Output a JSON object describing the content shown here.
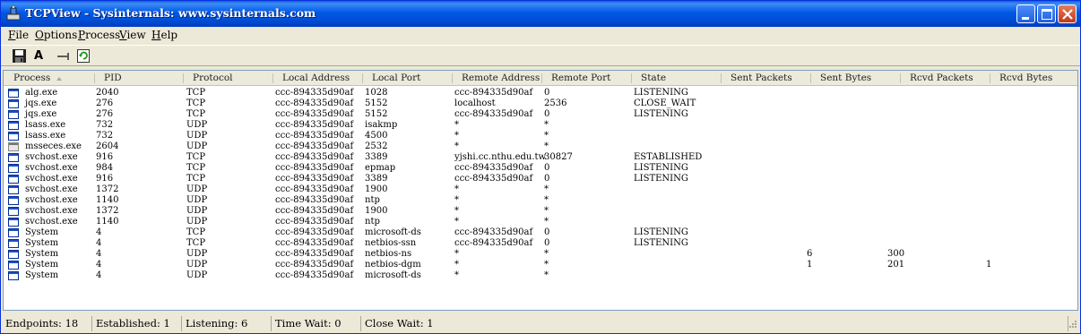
{
  "window": {
    "title": "TCPView - Sysinternals: www.sysinternals.com",
    "colors": {
      "titlebar": "#0058e6",
      "close_button": "#c4381c",
      "listening": "#000000"
    }
  },
  "menu": {
    "file": {
      "mnemonic": "F",
      "rest": "ile"
    },
    "options": {
      "mnemonic": "O",
      "rest": "ptions"
    },
    "process": {
      "mnemonic": "P",
      "rest": "rocess"
    },
    "view": {
      "mnemonic": "V",
      "rest": "iew"
    },
    "help": {
      "mnemonic": "H",
      "rest": "elp"
    }
  },
  "toolbar": {
    "save_icon": "floppy-disk-icon",
    "font_label": "A",
    "resolve_icon": "arrow-right-icon",
    "refresh_icon": "refresh-icon"
  },
  "columns": [
    "Process",
    "PID",
    "Protocol",
    "Local Address",
    "Local Port",
    "Remote Address",
    "Remote Port",
    "State",
    "Sent Packets",
    "Sent Bytes",
    "Rcvd Packets",
    "Rcvd Bytes"
  ],
  "rows": [
    {
      "icon": "app",
      "process": "alg.exe",
      "pid": "2040",
      "protocol": "TCP",
      "local_address": "ccc-894335d90af",
      "local_port": "1028",
      "remote_address": "ccc-894335d90af",
      "remote_port": "0",
      "state": "LISTENING",
      "sent_packets": "",
      "sent_bytes": "",
      "rcvd_packets": "",
      "rcvd_bytes": ""
    },
    {
      "icon": "app",
      "process": "jqs.exe",
      "pid": "276",
      "protocol": "TCP",
      "local_address": "ccc-894335d90af",
      "local_port": "5152",
      "remote_address": "localhost",
      "remote_port": "2536",
      "state": "CLOSE_WAIT",
      "sent_packets": "",
      "sent_bytes": "",
      "rcvd_packets": "",
      "rcvd_bytes": ""
    },
    {
      "icon": "app",
      "process": "jqs.exe",
      "pid": "276",
      "protocol": "TCP",
      "local_address": "ccc-894335d90af",
      "local_port": "5152",
      "remote_address": "ccc-894335d90af",
      "remote_port": "0",
      "state": "LISTENING",
      "sent_packets": "",
      "sent_bytes": "",
      "rcvd_packets": "",
      "rcvd_bytes": ""
    },
    {
      "icon": "app",
      "process": "lsass.exe",
      "pid": "732",
      "protocol": "UDP",
      "local_address": "ccc-894335d90af",
      "local_port": "isakmp",
      "remote_address": "*",
      "remote_port": "*",
      "state": "",
      "sent_packets": "",
      "sent_bytes": "",
      "rcvd_packets": "",
      "rcvd_bytes": ""
    },
    {
      "icon": "app",
      "process": "lsass.exe",
      "pid": "732",
      "protocol": "UDP",
      "local_address": "ccc-894335d90af",
      "local_port": "4500",
      "remote_address": "*",
      "remote_port": "*",
      "state": "",
      "sent_packets": "",
      "sent_bytes": "",
      "rcvd_packets": "",
      "rcvd_bytes": ""
    },
    {
      "icon": "ms",
      "process": "msseces.exe",
      "pid": "2604",
      "protocol": "UDP",
      "local_address": "ccc-894335d90af",
      "local_port": "2532",
      "remote_address": "*",
      "remote_port": "*",
      "state": "",
      "sent_packets": "",
      "sent_bytes": "",
      "rcvd_packets": "",
      "rcvd_bytes": ""
    },
    {
      "icon": "app",
      "process": "svchost.exe",
      "pid": "916",
      "protocol": "TCP",
      "local_address": "ccc-894335d90af",
      "local_port": "3389",
      "remote_address": "yjshi.cc.nthu.edu.tw",
      "remote_port": "30827",
      "state": "ESTABLISHED",
      "sent_packets": "",
      "sent_bytes": "",
      "rcvd_packets": "",
      "rcvd_bytes": ""
    },
    {
      "icon": "app",
      "process": "svchost.exe",
      "pid": "984",
      "protocol": "TCP",
      "local_address": "ccc-894335d90af",
      "local_port": "epmap",
      "remote_address": "ccc-894335d90af",
      "remote_port": "0",
      "state": "LISTENING",
      "sent_packets": "",
      "sent_bytes": "",
      "rcvd_packets": "",
      "rcvd_bytes": ""
    },
    {
      "icon": "app",
      "process": "svchost.exe",
      "pid": "916",
      "protocol": "TCP",
      "local_address": "ccc-894335d90af",
      "local_port": "3389",
      "remote_address": "ccc-894335d90af",
      "remote_port": "0",
      "state": "LISTENING",
      "sent_packets": "",
      "sent_bytes": "",
      "rcvd_packets": "",
      "rcvd_bytes": ""
    },
    {
      "icon": "app",
      "process": "svchost.exe",
      "pid": "1372",
      "protocol": "UDP",
      "local_address": "ccc-894335d90af",
      "local_port": "1900",
      "remote_address": "*",
      "remote_port": "*",
      "state": "",
      "sent_packets": "",
      "sent_bytes": "",
      "rcvd_packets": "",
      "rcvd_bytes": ""
    },
    {
      "icon": "app",
      "process": "svchost.exe",
      "pid": "1140",
      "protocol": "UDP",
      "local_address": "ccc-894335d90af",
      "local_port": "ntp",
      "remote_address": "*",
      "remote_port": "*",
      "state": "",
      "sent_packets": "",
      "sent_bytes": "",
      "rcvd_packets": "",
      "rcvd_bytes": ""
    },
    {
      "icon": "app",
      "process": "svchost.exe",
      "pid": "1372",
      "protocol": "UDP",
      "local_address": "ccc-894335d90af",
      "local_port": "1900",
      "remote_address": "*",
      "remote_port": "*",
      "state": "",
      "sent_packets": "",
      "sent_bytes": "",
      "rcvd_packets": "",
      "rcvd_bytes": ""
    },
    {
      "icon": "app",
      "process": "svchost.exe",
      "pid": "1140",
      "protocol": "UDP",
      "local_address": "ccc-894335d90af",
      "local_port": "ntp",
      "remote_address": "*",
      "remote_port": "*",
      "state": "",
      "sent_packets": "",
      "sent_bytes": "",
      "rcvd_packets": "",
      "rcvd_bytes": ""
    },
    {
      "icon": "sys",
      "process": "System",
      "pid": "4",
      "protocol": "TCP",
      "local_address": "ccc-894335d90af",
      "local_port": "microsoft-ds",
      "remote_address": "ccc-894335d90af",
      "remote_port": "0",
      "state": "LISTENING",
      "sent_packets": "",
      "sent_bytes": "",
      "rcvd_packets": "",
      "rcvd_bytes": ""
    },
    {
      "icon": "sys",
      "process": "System",
      "pid": "4",
      "protocol": "TCP",
      "local_address": "ccc-894335d90af",
      "local_port": "netbios-ssn",
      "remote_address": "ccc-894335d90af",
      "remote_port": "0",
      "state": "LISTENING",
      "sent_packets": "",
      "sent_bytes": "",
      "rcvd_packets": "",
      "rcvd_bytes": ""
    },
    {
      "icon": "sys",
      "process": "System",
      "pid": "4",
      "protocol": "UDP",
      "local_address": "ccc-894335d90af",
      "local_port": "netbios-ns",
      "remote_address": "*",
      "remote_port": "*",
      "state": "",
      "sent_packets": "6",
      "sent_bytes": "300",
      "rcvd_packets": "",
      "rcvd_bytes": ""
    },
    {
      "icon": "sys",
      "process": "System",
      "pid": "4",
      "protocol": "UDP",
      "local_address": "ccc-894335d90af",
      "local_port": "netbios-dgm",
      "remote_address": "*",
      "remote_port": "*",
      "state": "",
      "sent_packets": "1",
      "sent_bytes": "201",
      "rcvd_packets": "1",
      "rcvd_bytes": ""
    },
    {
      "icon": "sys",
      "process": "System",
      "pid": "4",
      "protocol": "UDP",
      "local_address": "ccc-894335d90af",
      "local_port": "microsoft-ds",
      "remote_address": "*",
      "remote_port": "*",
      "state": "",
      "sent_packets": "",
      "sent_bytes": "",
      "rcvd_packets": "",
      "rcvd_bytes": ""
    }
  ],
  "status": {
    "endpoints": "Endpoints: 18",
    "established": "Established: 1",
    "listening": "Listening: 6",
    "time_wait": "Time Wait: 0",
    "close_wait": "Close Wait: 1"
  }
}
